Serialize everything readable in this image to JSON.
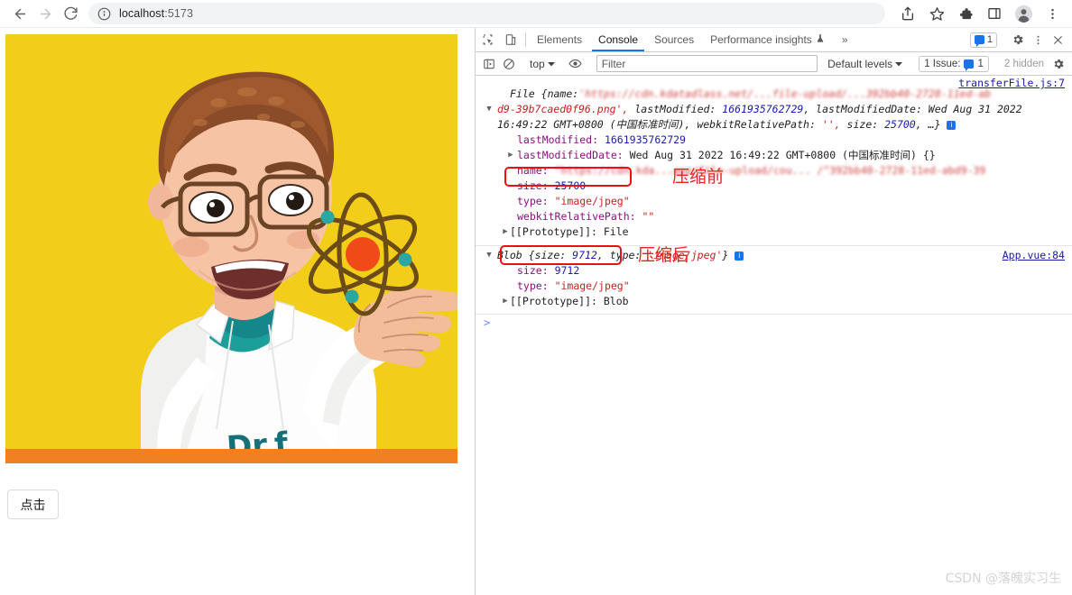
{
  "browser": {
    "nav": {
      "back_label": "Back",
      "forward_label": "Forward",
      "reload_label": "Reload"
    },
    "omnibox": {
      "info_icon": "info-circle-icon",
      "host": "localhost",
      "port": ":5173",
      "full_url": "localhost:5173"
    },
    "actions": [
      {
        "name": "share-icon",
        "label": "Share"
      },
      {
        "name": "bookmark-star-icon",
        "label": "Bookmark this tab"
      },
      {
        "name": "extensions-puzzle-icon",
        "label": "Extensions"
      },
      {
        "name": "side-panel-icon",
        "label": "Side panel"
      },
      {
        "name": "profile-avatar-icon",
        "label": "Profile"
      },
      {
        "name": "chrome-menu-icon",
        "label": "Customize and control Google Chrome"
      }
    ]
  },
  "page": {
    "illustration": {
      "alt": "Cartoon scientist with glasses presenting an atom",
      "background_color": "#f2cd1a",
      "accent_bar_color": "#f08022",
      "coat_text": "Dr.f",
      "nucleus_color": "#ef4a18",
      "electron_color": "#2aa7a0",
      "orbit_color": "#6b4b17"
    },
    "click_button_label": "点击"
  },
  "devtools": {
    "tools": [
      {
        "name": "inspect-element-icon",
        "label": "Inspect element"
      },
      {
        "name": "device-toolbar-icon",
        "label": "Toggle device toolbar"
      }
    ],
    "tabs": [
      {
        "label": "Elements",
        "active": false
      },
      {
        "label": "Console",
        "active": true
      },
      {
        "label": "Sources",
        "active": false
      },
      {
        "label": "Performance insights",
        "active": false,
        "beaker": "⚗"
      }
    ],
    "overflow_label": "»",
    "message_badge": {
      "count": "1",
      "icon": "message-bubble-icon"
    },
    "right_icons": [
      {
        "name": "settings-gear-icon",
        "label": "Settings"
      },
      {
        "name": "more-options-icon",
        "label": "More options"
      },
      {
        "name": "close-devtools-icon",
        "label": "Close DevTools"
      }
    ],
    "filterbar": {
      "sidebar_toggle": "console-sidebar-icon",
      "clear_console": "clear-console-icon",
      "context": "top",
      "eye_icon": "live-expression-eye-icon",
      "filter_placeholder": "Filter",
      "filter_value": "",
      "levels": "Default levels",
      "issues_label": "1 Issue:",
      "issues_count": "1",
      "hidden_label": "2 hidden",
      "settings_gear": "console-settings-gear-icon"
    },
    "console": {
      "prompt": ">",
      "entries": [
        {
          "source_link": "transferFile.js:7",
          "header_parts": {
            "ctor": "File",
            "open_brace": "{",
            "name_key": "name:",
            "name_value_blurred": "'https://cdn.kdatadlass.net/...file-upload/...392bb40-2728-11ed-ab",
            "name_value_tail": "d9-39b7caed0f96.png',",
            "lastModified_key": "lastModified:",
            "lastModified_value": "1661935762729",
            "lastModifiedDate_key": "lastModifiedDate:",
            "lastModifiedDate_value": "Wed Aug 31 2022 16:49:22 GMT+0800 (中国标准时间),",
            "webkitRelativePath_key": "webkitRelativePath:",
            "webkitRelativePath_value": "'',",
            "size_key": "size:",
            "size_value": "25700",
            "ellipsis": ", …}"
          },
          "properties": [
            {
              "key": "lastModified:",
              "value": "1661935762729",
              "type": "num",
              "expandable": false
            },
            {
              "key": "lastModifiedDate:",
              "value": "Wed Aug 31 2022 16:49:22 GMT+0800 (中国标准时间) {}",
              "type": "plain",
              "expandable": true
            },
            {
              "key": "name:",
              "value": "\"https://cdn.kda...app/file-upload/cou... /^392bb40-2728-11ed-abd9-39",
              "type": "str",
              "expandable": false,
              "blurred": true
            },
            {
              "key": "size:",
              "value": "25700",
              "type": "num",
              "expandable": false,
              "highlight": true
            },
            {
              "key": "type:",
              "value": "\"image/jpeg\"",
              "type": "str",
              "expandable": false
            },
            {
              "key": "webkitRelativePath:",
              "value": "\"\"",
              "type": "str",
              "expandable": false
            },
            {
              "key": "[[Prototype]]:",
              "value": "File",
              "type": "plain",
              "expandable": true
            }
          ],
          "annotation": "压缩前"
        },
        {
          "source_link": "App.vue:84",
          "header_parts": {
            "ctor": "Blob",
            "open_brace": "{",
            "size_key": "size:",
            "size_value": "9712",
            "comma": ",",
            "type_key": "type:",
            "type_value": "'image/jpeg'",
            "close_brace": "}"
          },
          "properties": [
            {
              "key": "size:",
              "value": "9712",
              "type": "num",
              "expandable": false,
              "highlight": true
            },
            {
              "key": "type:",
              "value": "\"image/jpeg\"",
              "type": "str",
              "expandable": false
            },
            {
              "key": "[[Prototype]]:",
              "value": "Blob",
              "type": "plain",
              "expandable": true
            }
          ],
          "annotation": "压缩后"
        }
      ]
    }
  },
  "watermark": "CSDN @落魄实习生"
}
